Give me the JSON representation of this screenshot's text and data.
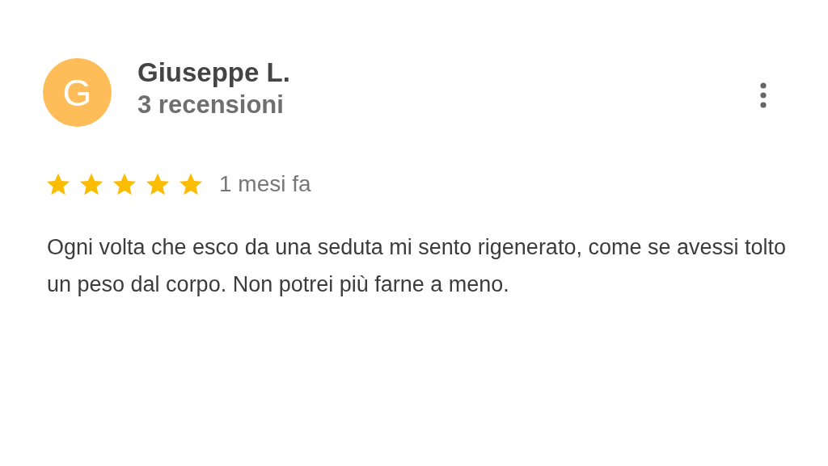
{
  "review": {
    "avatar_letter": "G",
    "author": "Giuseppe L.",
    "reviews_count": "3 recensioni",
    "stars": 5,
    "time": "1 mesi fa",
    "text": "Ogni volta che esco da una seduta mi sento rigenerato, come se avessi tolto un peso dal corpo. Non potrei più farne a meno."
  }
}
